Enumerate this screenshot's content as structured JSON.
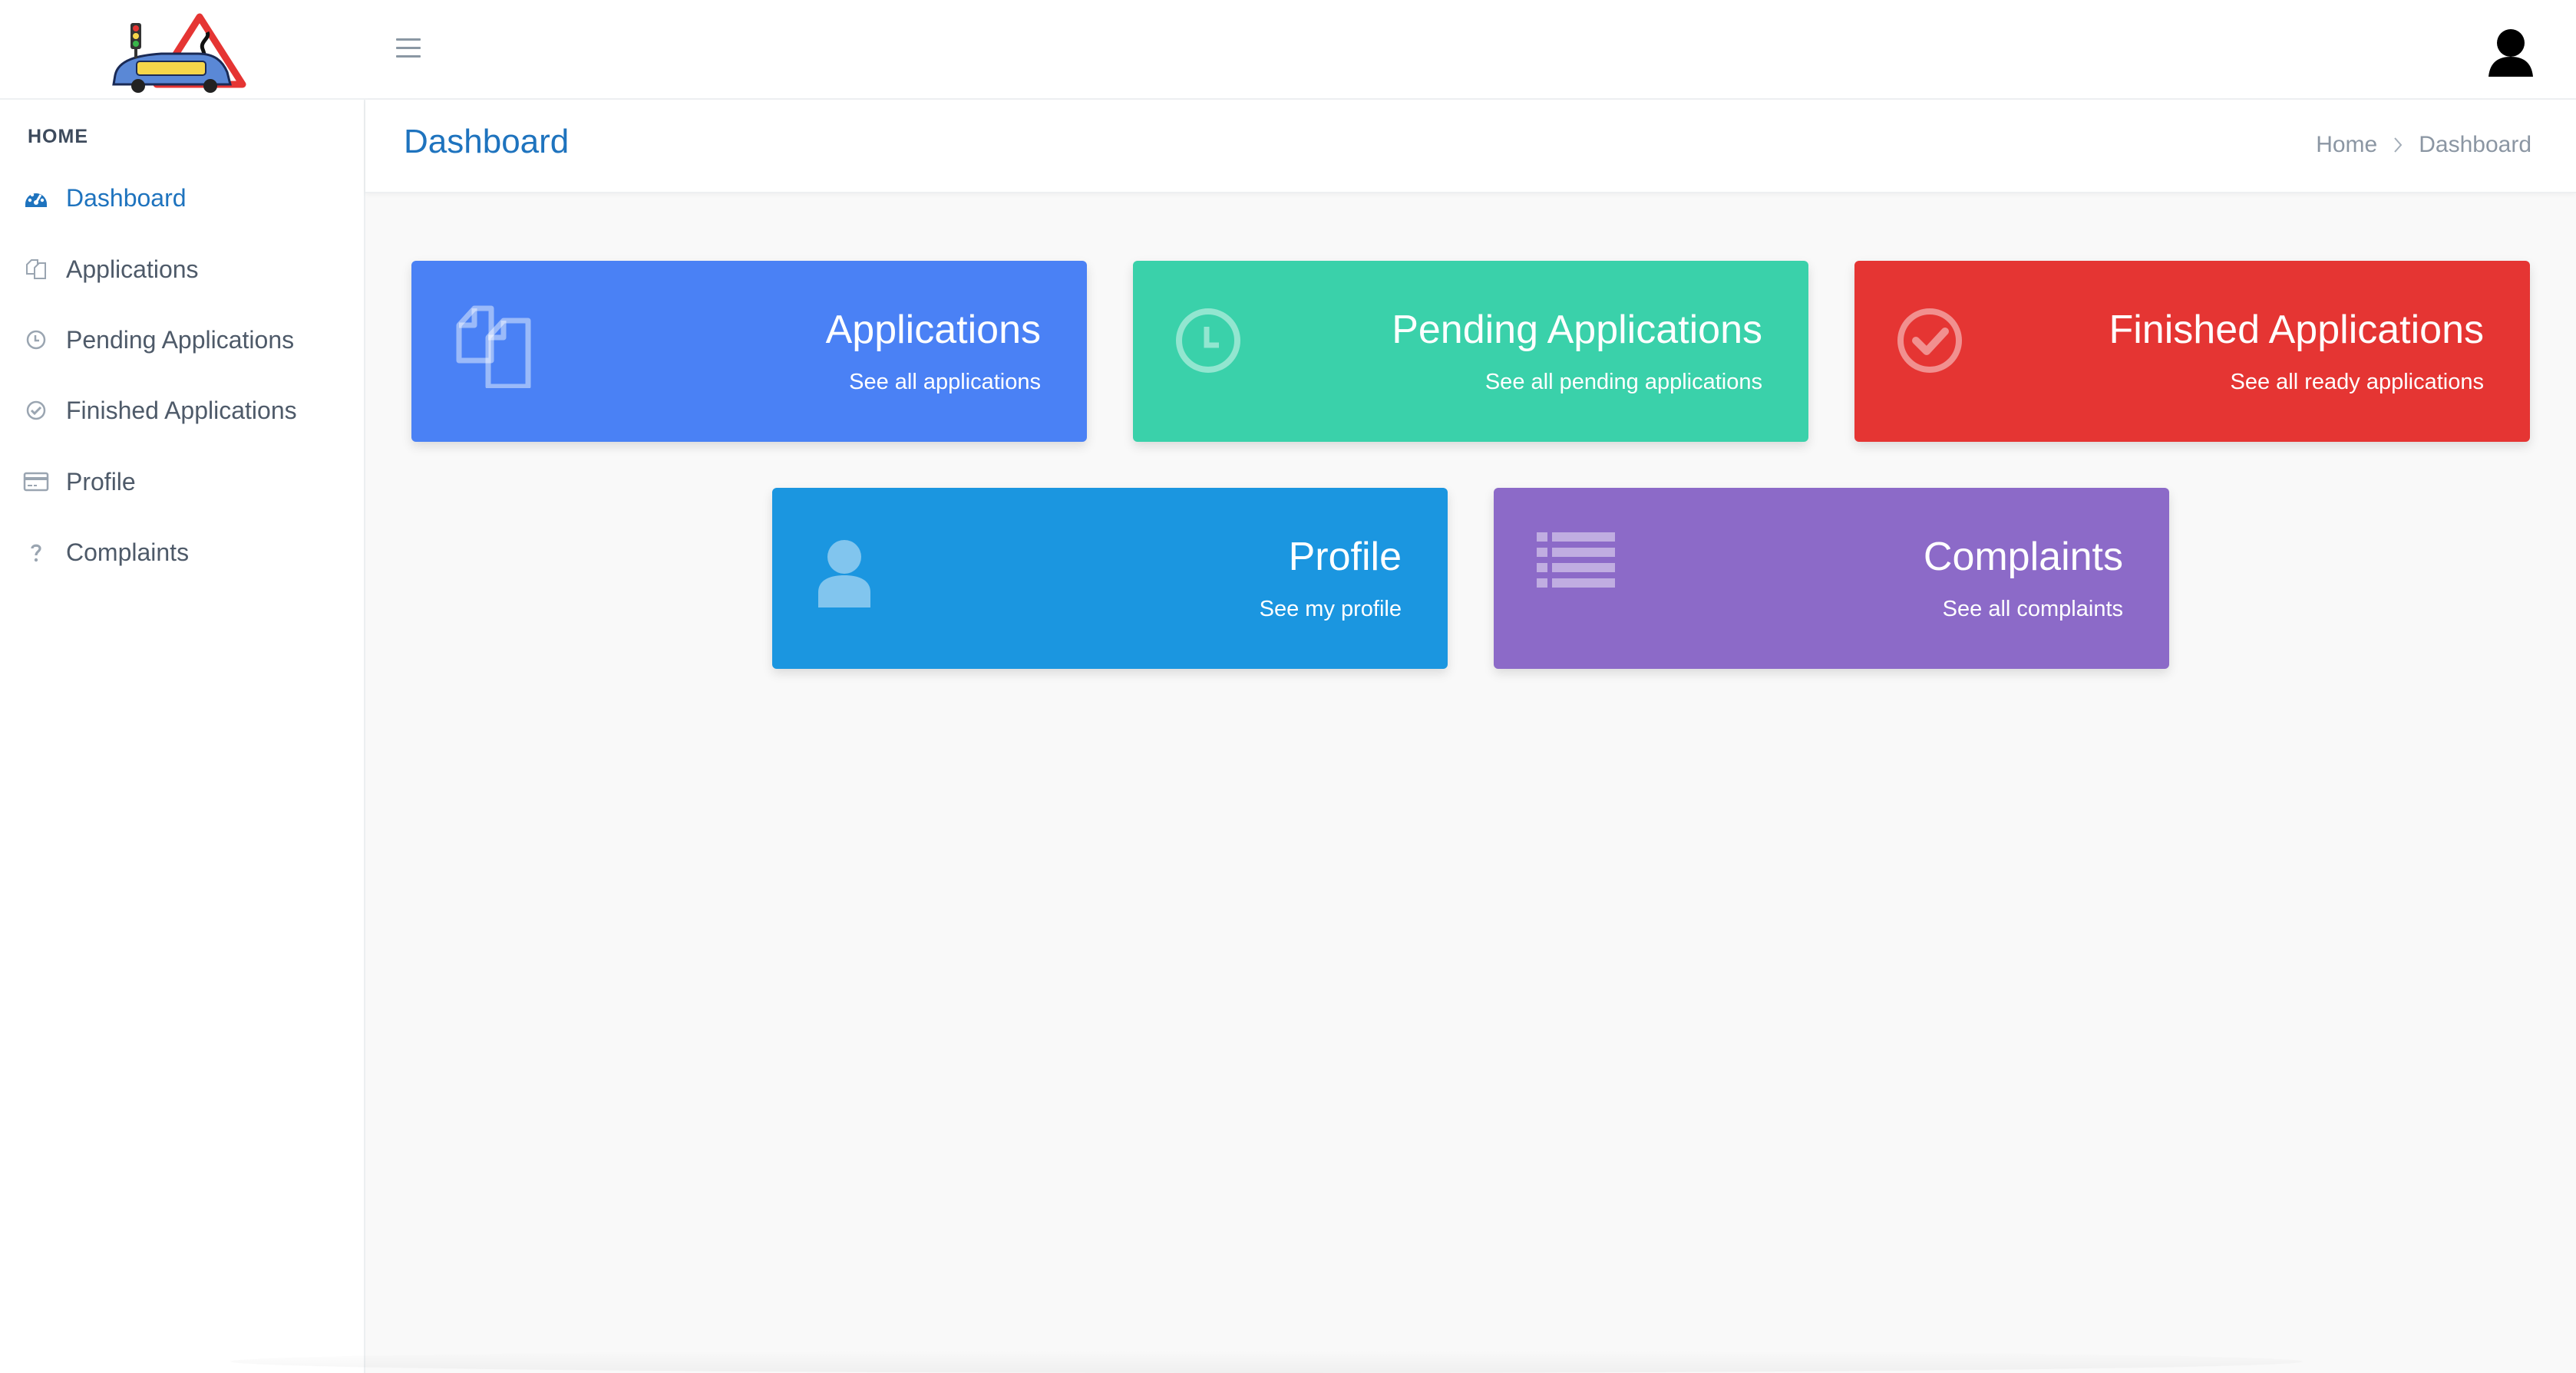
{
  "header": {
    "logo_name": "driving-school-logo",
    "menu_icon": "hamburger-icon",
    "user_icon": "user-avatar-icon"
  },
  "sidebar": {
    "heading": "HOME",
    "items": [
      {
        "label": "Dashboard",
        "icon": "dashboard-gauge-icon",
        "active": true
      },
      {
        "label": "Applications",
        "icon": "copy-icon",
        "active": false
      },
      {
        "label": "Pending Applications",
        "icon": "clock-icon",
        "active": false
      },
      {
        "label": "Finished Applications",
        "icon": "check-circle-icon",
        "active": false
      },
      {
        "label": "Profile",
        "icon": "id-card-icon",
        "active": false
      },
      {
        "label": "Complaints",
        "icon": "question-icon",
        "active": false
      }
    ]
  },
  "page": {
    "title": "Dashboard",
    "breadcrumb": {
      "home": "Home",
      "current": "Dashboard"
    }
  },
  "cards": [
    {
      "title": "Applications",
      "subtitle": "See all applications",
      "color": "#4a81f5",
      "icon": "copy-icon"
    },
    {
      "title": "Pending Applications",
      "subtitle": "See all pending applications",
      "color": "#3ad1aa",
      "icon": "clock-icon"
    },
    {
      "title": "Finished Applications",
      "subtitle": "See all ready applications",
      "color": "#e53533",
      "icon": "check-circle-icon"
    },
    {
      "title": "Profile",
      "subtitle": "See my profile",
      "color": "#1b96e0",
      "icon": "user-icon"
    },
    {
      "title": "Complaints",
      "subtitle": "See all complaints",
      "color": "#8c6ac8",
      "icon": "list-icon"
    }
  ],
  "colors": {
    "accent": "#1e73be",
    "sidebar_text": "#4e5a69",
    "background": "#f9f9f9"
  }
}
